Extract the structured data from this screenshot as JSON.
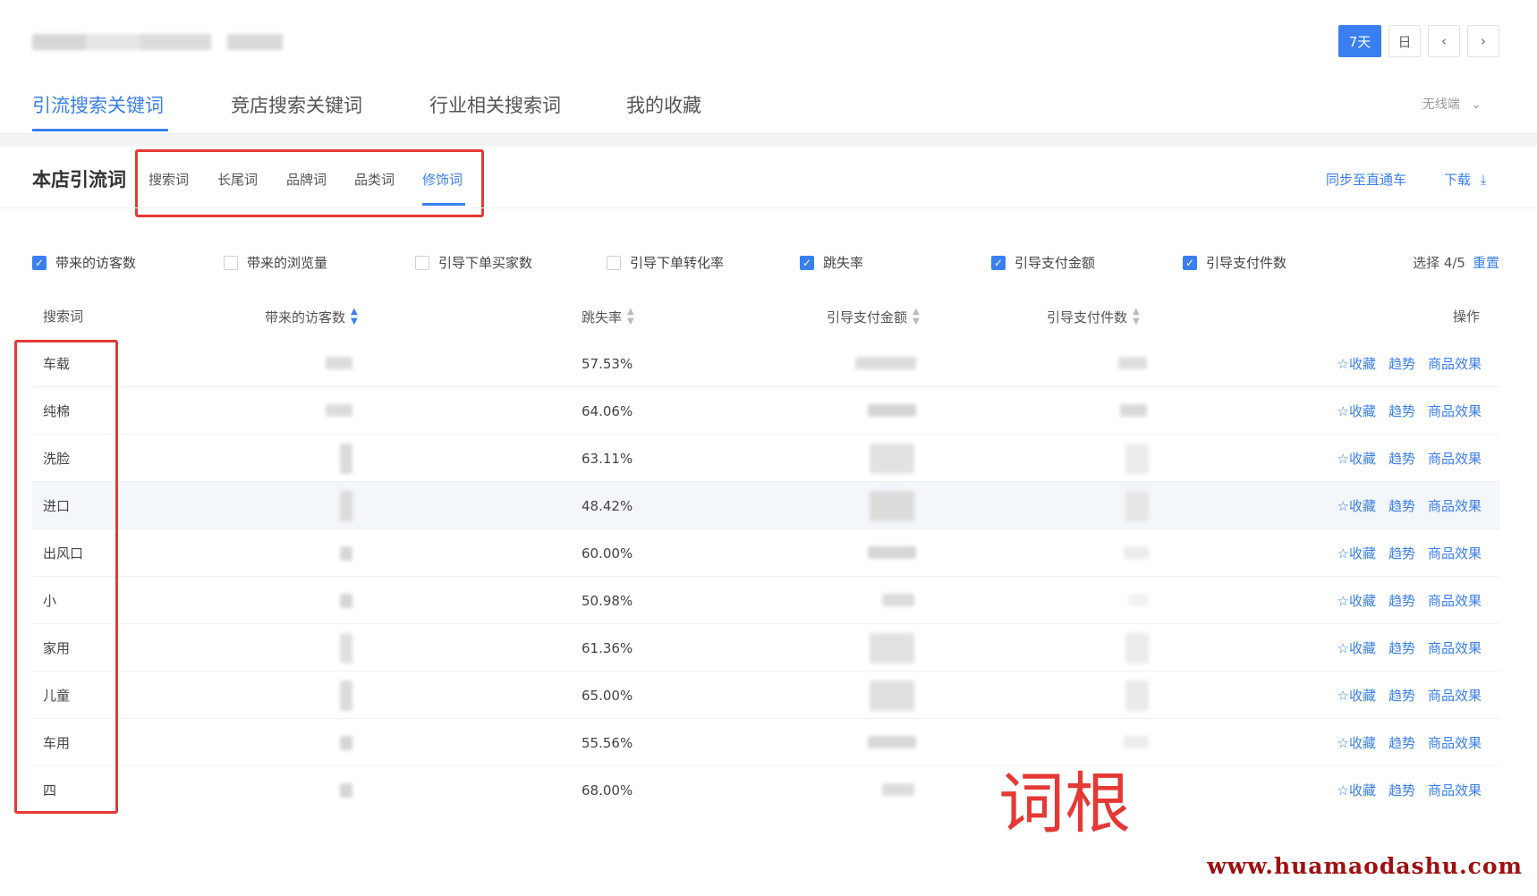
{
  "header": {
    "date_controls": [
      {
        "label": "7天",
        "active": true
      },
      {
        "label": "日",
        "active": false
      },
      {
        "label": "‹",
        "active": false
      },
      {
        "label": "›",
        "active": false
      }
    ]
  },
  "main_tabs": [
    {
      "label": "引流搜索关键词",
      "active": true
    },
    {
      "label": "竞店搜索关键词",
      "active": false
    },
    {
      "label": "行业相关搜索词",
      "active": false
    },
    {
      "label": "我的收藏",
      "active": false
    }
  ],
  "device_select": {
    "label": "无线端",
    "icon": "chevron-down-icon"
  },
  "section": {
    "title": "本店引流词",
    "sub_tabs": [
      {
        "label": "搜索词",
        "active": false
      },
      {
        "label": "长尾词",
        "active": false
      },
      {
        "label": "品牌词",
        "active": false
      },
      {
        "label": "品类词",
        "active": false
      },
      {
        "label": "修饰词",
        "active": true
      }
    ],
    "sync_link": "同步至直通车",
    "download_link": "下载",
    "download_icon": "download-icon"
  },
  "metrics": [
    {
      "label": "带来的访客数",
      "checked": true
    },
    {
      "label": "带来的浏览量",
      "checked": false
    },
    {
      "label": "引导下单买家数",
      "checked": false
    },
    {
      "label": "引导下单转化率",
      "checked": false
    },
    {
      "label": "跳失率",
      "checked": true
    },
    {
      "label": "引导支付金额",
      "checked": true
    },
    {
      "label": "引导支付件数",
      "checked": true
    }
  ],
  "selection": {
    "text": "选择 4/5",
    "reset": "重置"
  },
  "table": {
    "columns": [
      {
        "label": "搜索词"
      },
      {
        "label": "带来的访客数",
        "sort": "active"
      },
      {
        "label": "跳失率",
        "sort": "neutral"
      },
      {
        "label": "引导支付金额",
        "sort": "neutral"
      },
      {
        "label": "引导支付件数",
        "sort": "neutral"
      },
      {
        "label": "操作"
      }
    ],
    "rows": [
      {
        "keyword": "车载",
        "bounce_rate": "57.53%"
      },
      {
        "keyword": "纯棉",
        "bounce_rate": "64.06%"
      },
      {
        "keyword": "洗脸",
        "bounce_rate": "63.11%"
      },
      {
        "keyword": "进口",
        "bounce_rate": "48.42%",
        "highlighted": true
      },
      {
        "keyword": "出风口",
        "bounce_rate": "60.00%"
      },
      {
        "keyword": "小",
        "bounce_rate": "50.98%"
      },
      {
        "keyword": "家用",
        "bounce_rate": "61.36%"
      },
      {
        "keyword": "儿童",
        "bounce_rate": "65.00%"
      },
      {
        "keyword": "车用",
        "bounce_rate": "55.56%"
      },
      {
        "keyword": "四",
        "bounce_rate": "68.00%"
      }
    ],
    "row_actions": {
      "favorite": "☆收藏",
      "trend": "趋势",
      "product_effect": "商品效果"
    }
  },
  "annotation": {
    "text": "词根",
    "color": "#e53935"
  },
  "watermark": "www.huamaodashu.com",
  "colors": {
    "accent": "#3a7ff0",
    "annotation_red": "#e53935"
  }
}
